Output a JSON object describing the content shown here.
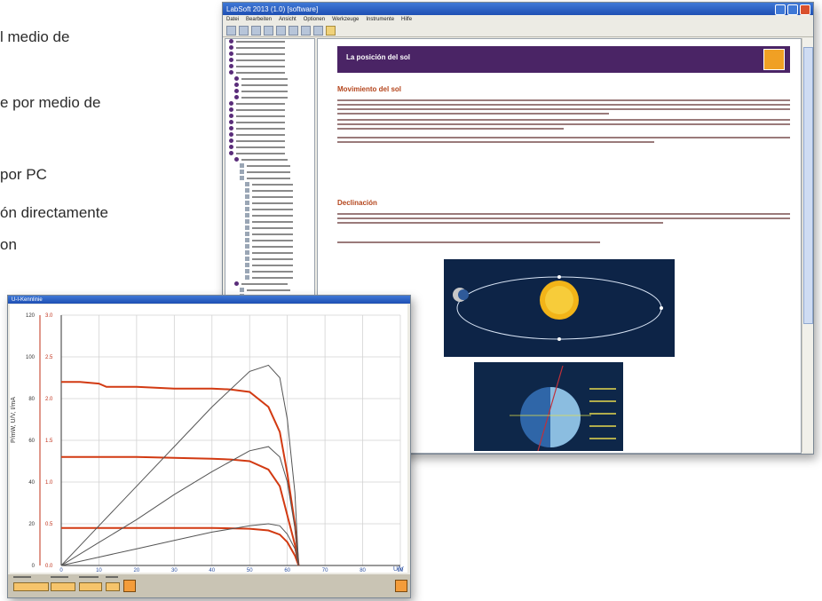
{
  "side_text": {
    "lines": [
      "l medio de",
      "e por medio de",
      "por PC",
      "ón directamente",
      "on"
    ]
  },
  "main_window": {
    "title": "LabSoft 2013 (1.0) [software]",
    "menu": [
      "Datei",
      "Bearbeiten",
      "Ansicht",
      "Optionen",
      "Werkzeuge",
      "Instrumente",
      "Hilfe"
    ],
    "page_header": "La posición del sol",
    "section_1": "Movimiento del sol",
    "section_2": "Declinación"
  },
  "graph_window": {
    "title": "U-I-Kennlinie",
    "y_left_label": "P/mW, U/V, I/mA",
    "x_unit": "U/V"
  },
  "chart_data": {
    "type": "line",
    "xlim": [
      0,
      90
    ],
    "x_ticks": [
      "0",
      "10",
      "20",
      "30",
      "40",
      "50",
      "60",
      "70",
      "80",
      "90"
    ],
    "y_left_lim": [
      0,
      120
    ],
    "y_left_ticks": [
      "0",
      "20",
      "40",
      "60",
      "80",
      "100",
      "120"
    ],
    "y_right_lim": [
      0,
      3.0
    ],
    "y_right_ticks": [
      "0.0",
      "0.5",
      "1.0",
      "1.5",
      "2.0",
      "2.5",
      "3.0"
    ],
    "grid": true,
    "series": [
      {
        "color": "#d23a12",
        "axis": "right",
        "x": [
          0,
          5,
          10,
          12,
          20,
          30,
          35,
          40,
          45,
          50,
          55,
          58,
          60,
          62,
          63
        ],
        "y": [
          2.2,
          2.2,
          2.18,
          2.14,
          2.14,
          2.12,
          2.12,
          2.12,
          2.11,
          2.08,
          1.9,
          1.6,
          1.1,
          0.5,
          0.0
        ]
      },
      {
        "color": "#d23a12",
        "axis": "right",
        "x": [
          0,
          10,
          20,
          30,
          40,
          45,
          50,
          55,
          58,
          60,
          62,
          63
        ],
        "y": [
          1.3,
          1.3,
          1.3,
          1.29,
          1.28,
          1.27,
          1.25,
          1.15,
          0.95,
          0.6,
          0.25,
          0.0
        ]
      },
      {
        "color": "#d23a12",
        "axis": "right",
        "x": [
          0,
          10,
          20,
          30,
          40,
          50,
          55,
          58,
          60,
          62,
          63
        ],
        "y": [
          0.45,
          0.45,
          0.45,
          0.45,
          0.45,
          0.44,
          0.42,
          0.37,
          0.28,
          0.12,
          0.0
        ]
      },
      {
        "color": "#555555",
        "axis": "left",
        "x": [
          0,
          10,
          20,
          30,
          40,
          50,
          55,
          58,
          60,
          62,
          63
        ],
        "y": [
          0,
          19,
          38,
          57,
          76,
          93,
          96,
          90,
          70,
          35,
          0
        ]
      },
      {
        "color": "#555555",
        "axis": "left",
        "x": [
          0,
          10,
          20,
          30,
          40,
          50,
          55,
          58,
          60,
          62,
          63
        ],
        "y": [
          0,
          11,
          22,
          34,
          45,
          55,
          57,
          52,
          40,
          18,
          0
        ]
      },
      {
        "color": "#555555",
        "axis": "left",
        "x": [
          0,
          10,
          20,
          30,
          40,
          50,
          55,
          58,
          60,
          62,
          63
        ],
        "y": [
          0,
          4,
          8,
          12,
          16,
          19,
          20,
          19,
          15,
          8,
          0
        ]
      }
    ]
  }
}
